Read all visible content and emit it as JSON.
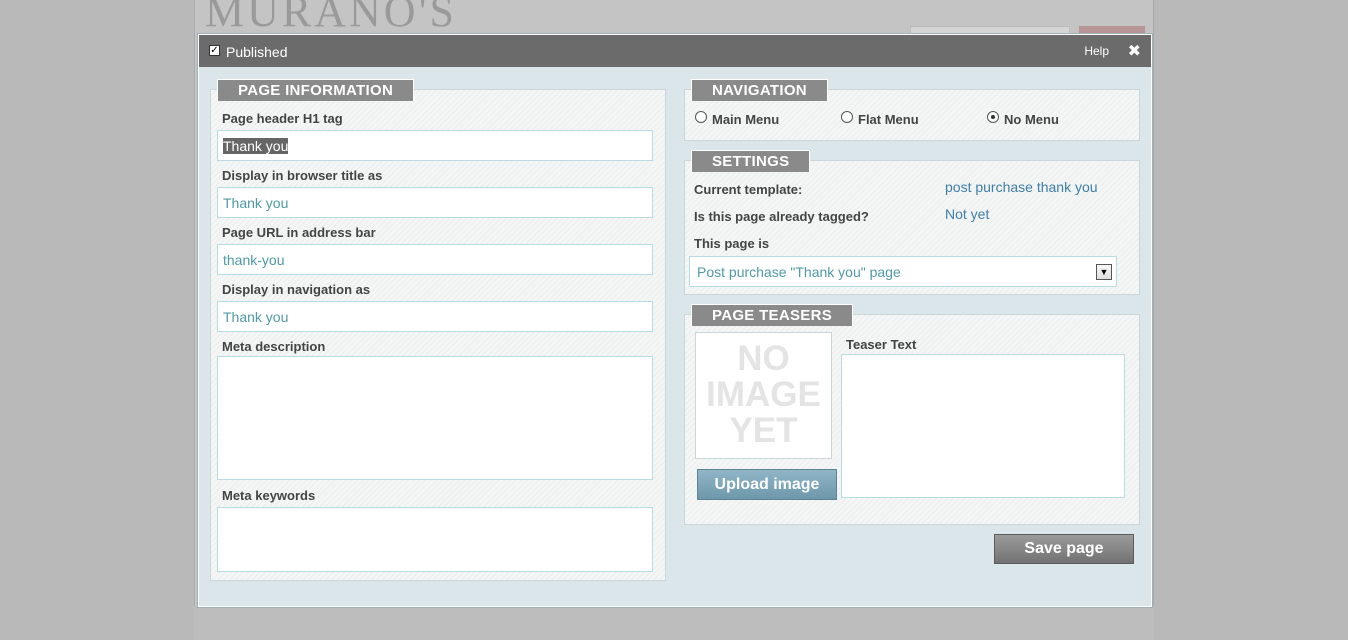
{
  "background": {
    "logo_text": "MURANO'S"
  },
  "header": {
    "published_label": "Published",
    "published_checked": true,
    "help_label": "Help",
    "close_glyph": "✖"
  },
  "page_information": {
    "title": "PAGE INFORMATION",
    "h1_label": "Page header H1 tag",
    "h1_value": "Thank you",
    "browser_title_label": "Display in browser title as",
    "browser_title_value": "Thank you",
    "url_label": "Page URL in address bar",
    "url_value": "thank-you",
    "nav_label": "Display in navigation as",
    "nav_value": "Thank you",
    "meta_description_label": "Meta description",
    "meta_keywords_label": "Meta keywords"
  },
  "navigation": {
    "title": "NAVIGATION",
    "options": [
      "Main Menu",
      "Flat Menu",
      "No Menu"
    ],
    "selected": "No Menu"
  },
  "settings": {
    "title": "SETTINGS",
    "template_label": "Current template:",
    "template_value": "post purchase thank you",
    "tagged_label": "Is this page already tagged?",
    "tagged_value": "Not yet",
    "page_is_label": "This page is",
    "page_is_value": "Post purchase \"Thank you\" page"
  },
  "teasers": {
    "title": "PAGE TEASERS",
    "placeholder_text_lines": [
      "NO",
      "IMAGE",
      "YET"
    ],
    "upload_label": "Upload image",
    "teaser_text_label": "Teaser Text"
  },
  "actions": {
    "save_label": "Save page"
  },
  "colors": {
    "header_bg": "#6b6b6b",
    "modal_bg": "#dae6ea",
    "tab_bg": "#8a8a8a",
    "value_text": "#4f9aa5",
    "link_text": "#3e7fa8",
    "upload_button": "#7ea6b9"
  }
}
